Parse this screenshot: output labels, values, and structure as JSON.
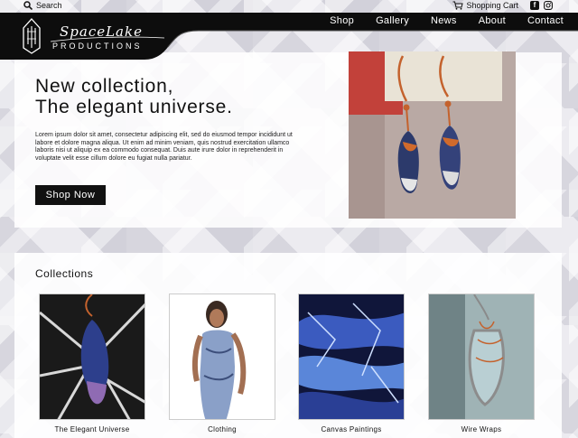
{
  "topbar": {
    "search_label": "Search",
    "cart_label": "Shopping Cart",
    "icons": [
      "search-icon",
      "cart-icon",
      "facebook-icon",
      "instagram-icon"
    ]
  },
  "brand": {
    "script": "SpaceLake",
    "sub": "PRODUCTIONS"
  },
  "nav": [
    {
      "label": "Shop"
    },
    {
      "label": "Gallery"
    },
    {
      "label": "News"
    },
    {
      "label": "About"
    },
    {
      "label": "Contact"
    }
  ],
  "hero": {
    "title_line1": "New collection,",
    "title_line2": "The elegant universe.",
    "body": "Lorem ipsum dolor sit amet, consectetur adipiscing elit, sed do eiusmod tempor incididunt ut labore et dolore magna aliqua. Ut enim ad minim veniam, quis nostrud exercitation ullamco laboris nisi ut aliquip ex ea commodo consequat. Duis aute irure dolor in reprehenderit in voluptate velit esse cillum dolore eu fugiat nulla pariatur.",
    "button_label": "Shop Now"
  },
  "collections": {
    "heading": "Collections",
    "items": [
      {
        "caption": "The Elegant Universe"
      },
      {
        "caption": "Clothing"
      },
      {
        "caption": "Canvas Paintings"
      },
      {
        "caption": "Wire Wraps"
      }
    ]
  },
  "colors": {
    "header_bg": "#0d0d0d",
    "button_bg": "#111111",
    "accent_copper": "#c4622d"
  }
}
